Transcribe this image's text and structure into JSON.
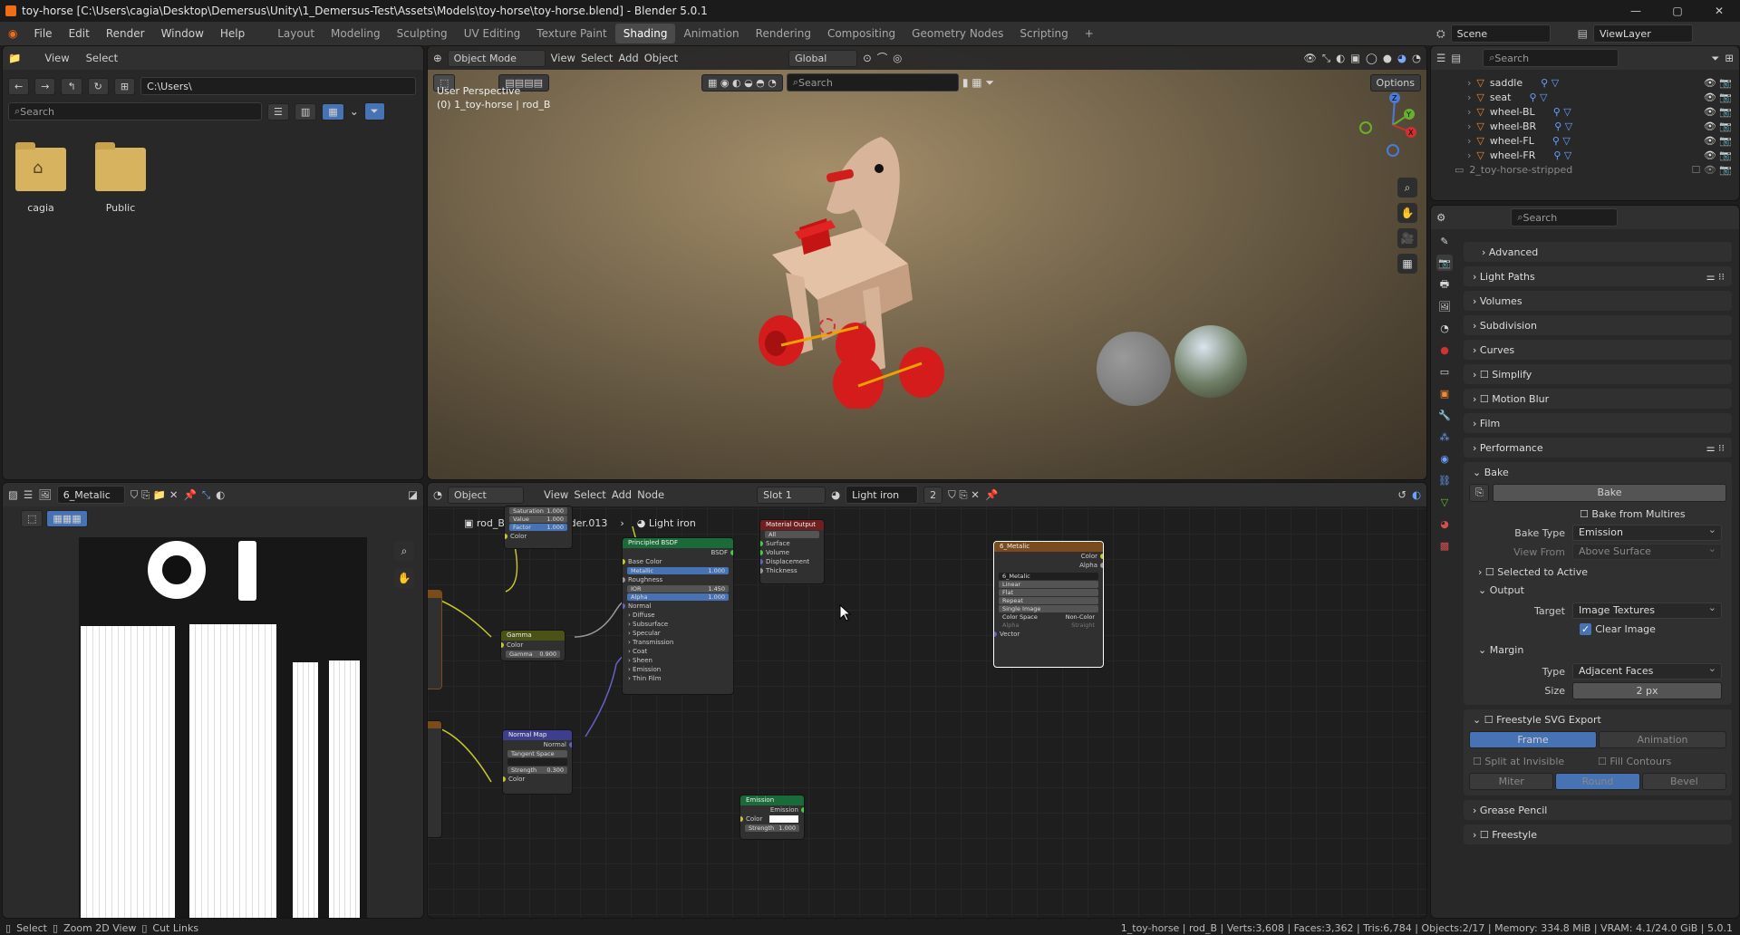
{
  "window": {
    "title": "toy-horse [C:\\Users\\cagia\\Desktop\\Demersus\\Unity\\1_Demersus-Test\\Assets\\Models\\toy-horse\\toy-horse.blend] - Blender 5.0.1"
  },
  "menu": [
    "File",
    "Edit",
    "Render",
    "Window",
    "Help"
  ],
  "workspaces": [
    "Layout",
    "Modeling",
    "Sculpting",
    "UV Editing",
    "Texture Paint",
    "Shading",
    "Animation",
    "Rendering",
    "Compositing",
    "Geometry Nodes",
    "Scripting"
  ],
  "active_workspace": "Shading",
  "scene": {
    "label": "Scene",
    "viewlayer": "ViewLayer"
  },
  "file_browser": {
    "menu": [
      "View",
      "Select"
    ],
    "path": "C:\\Users\\",
    "search": "Search",
    "folders": [
      "cagia",
      "Public"
    ]
  },
  "viewport": {
    "mode": "Object Mode",
    "menu": [
      "View",
      "Select",
      "Add",
      "Object"
    ],
    "orientation": "Global",
    "search": "Search",
    "options": "Options",
    "info_line1": "User Perspective",
    "info_line2": "(0) 1_toy-horse | rod_B"
  },
  "outliner": {
    "search": "Search",
    "items": [
      "saddle",
      "seat",
      "wheel-BL",
      "wheel-BR",
      "wheel-FL",
      "wheel-FR"
    ],
    "collection": "2_toy-horse-stripped"
  },
  "image_editor": {
    "image": "6_Metalic"
  },
  "node_editor": {
    "type": "Object",
    "menu": [
      "View",
      "Select",
      "Add",
      "Node"
    ],
    "slot": "Slot 1",
    "material": "Light iron",
    "users": "2",
    "breadcrumb": [
      "rod_B",
      "Cylinder.013",
      "Light iron"
    ],
    "nodes": {
      "huesat": {
        "rows": [
          [
            "Saturation",
            "1.000"
          ],
          [
            "Value",
            "1.000"
          ],
          [
            "Factor",
            "1.000"
          ]
        ],
        "out": "Color"
      },
      "gamma": {
        "title": "Gamma",
        "color": "Color",
        "gamma_label": "Gamma",
        "gamma_value": "0.900"
      },
      "normalmap": {
        "title": "Normal Map",
        "out": "Normal",
        "space": "Tangent Space",
        "strength_label": "Strength",
        "strength_value": "0.300",
        "color": "Color"
      },
      "bsdf": {
        "title": "Principled BSDF",
        "out": "BSDF",
        "base_color": "Base Color",
        "metallic_label": "Metallic",
        "metallic_value": "1.000",
        "roughness": "Roughness",
        "ior_label": "IOR",
        "ior_value": "1.450",
        "alpha_label": "Alpha",
        "alpha_value": "1.000",
        "normal": "Normal",
        "panels": [
          "Diffuse",
          "Subsurface",
          "Specular",
          "Transmission",
          "Coat",
          "Sheen",
          "Emission",
          "Thin Film"
        ]
      },
      "output": {
        "title": "Material Output",
        "target": "All",
        "inputs": [
          "Surface",
          "Volume",
          "Displacement",
          "Thickness"
        ]
      },
      "image": {
        "title": "6_Metalic",
        "out_color": "Color",
        "out_alpha": "Alpha",
        "name": "6_Metalic",
        "interp": "Linear",
        "proj": "Flat",
        "ext": "Repeat",
        "source": "Single Image",
        "cs_label": "Color Space",
        "cs_value": "Non-Color",
        "alpha_label": "Alpha",
        "alpha_value": "Straight",
        "vector": "Vector"
      },
      "emission": {
        "title": "Emission",
        "out": "Emission",
        "color": "Color",
        "strength_label": "Strength",
        "strength_value": "1.000"
      }
    }
  },
  "properties": {
    "search": "Search",
    "sections": [
      "Advanced",
      "Light Paths",
      "Volumes",
      "Subdivision",
      "Curves",
      "Simplify",
      "Motion Blur",
      "Film",
      "Performance"
    ],
    "bake": {
      "title": "Bake",
      "button": "Bake",
      "multires": "Bake from Multires",
      "type_label": "Bake Type",
      "type_value": "Emission",
      "view_label": "View From",
      "view_value": "Above Surface",
      "selected": "Selected to Active",
      "output": "Output",
      "target_label": "Target",
      "target_value": "Image Textures",
      "clear": "Clear Image",
      "margin": "Margin",
      "mtype_label": "Type",
      "mtype_value": "Adjacent Faces",
      "size_label": "Size",
      "size_value": "2 px"
    },
    "freestyle_svg": {
      "title": "Freestyle SVG Export",
      "frame": "Frame",
      "animation": "Animation",
      "split": "Split at Invisible",
      "fill": "Fill Contours",
      "miter": "Miter",
      "round": "Round",
      "bevel": "Bevel"
    },
    "grease": "Grease Pencil",
    "freestyle": "Freestyle"
  },
  "status": {
    "left": [
      "Select",
      "Zoom 2D View",
      "Cut Links"
    ],
    "right": "1_toy-horse | rod_B | Verts:3,608 | Faces:3,362 | Tris:6,784 | Objects:2/17 | Memory: 334.8 MiB | VRAM: 4.1/24.0 GiB | 5.0.1"
  },
  "colors": {
    "accent": "#4772b3",
    "orange": "#ef6c19",
    "node_bsdf": "#1b6b3a",
    "node_output": "#6e1f1f",
    "node_image": "#7a4b1c",
    "node_gamma": "#4a5216",
    "node_normal": "#3e3e8e"
  }
}
